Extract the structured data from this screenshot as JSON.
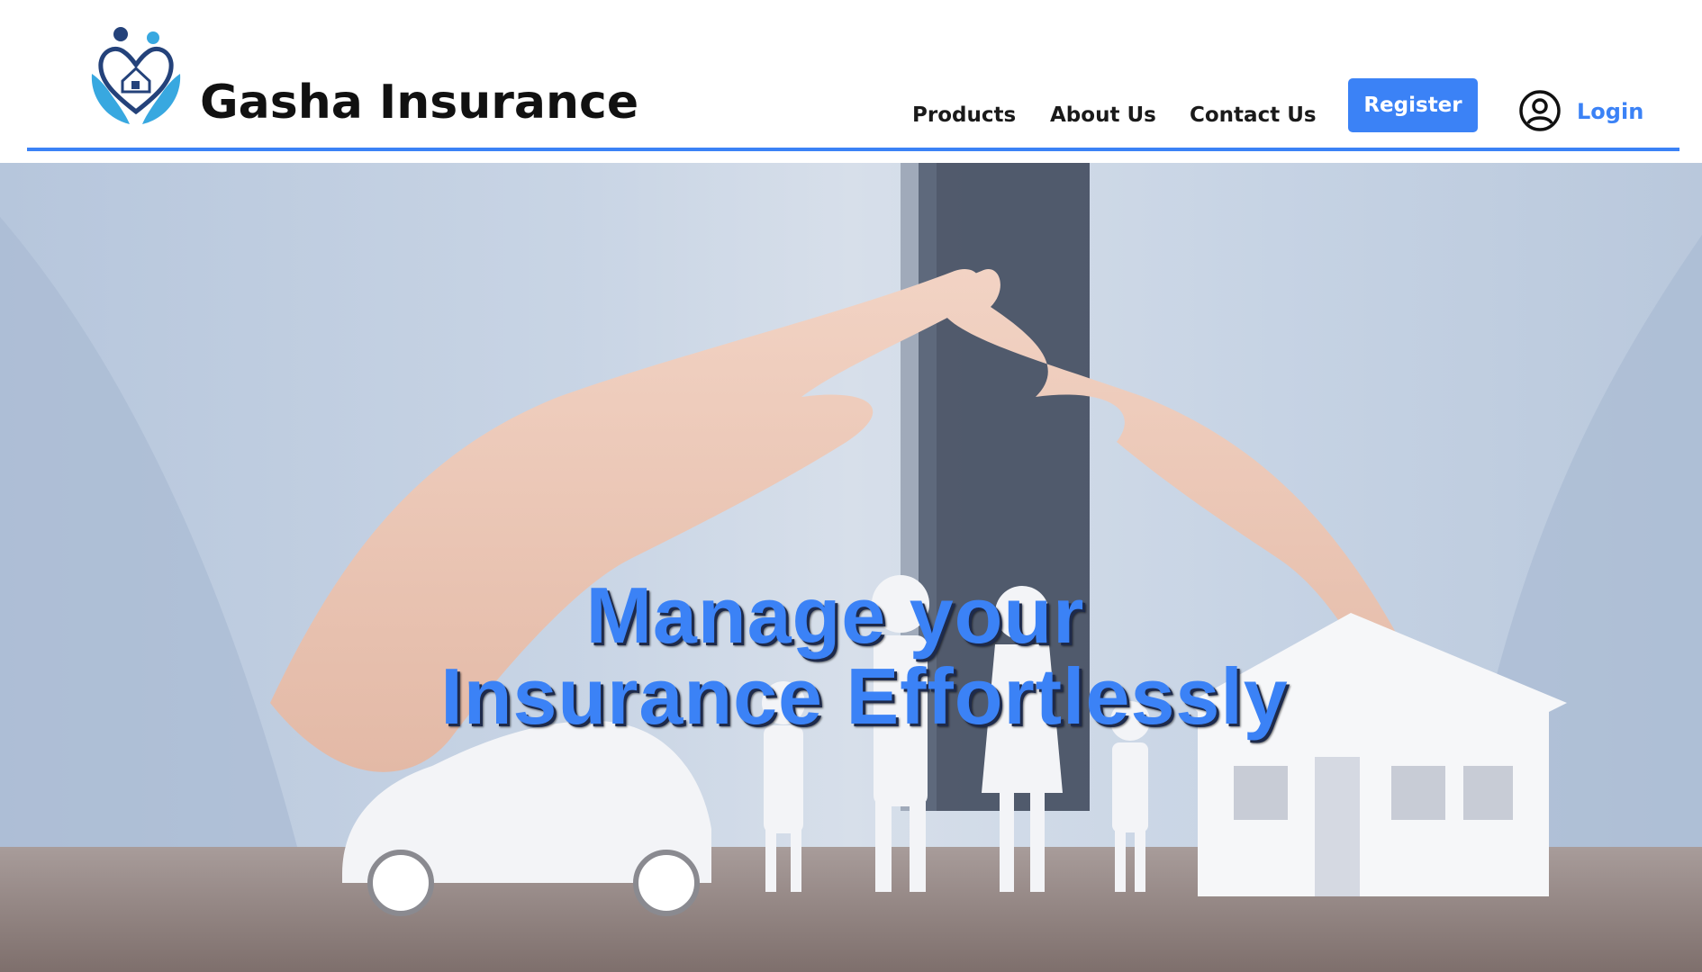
{
  "header": {
    "brand": "Gasha Insurance",
    "logo_icon": "family-hands-house-logo",
    "nav": {
      "products": "Products",
      "about": "About Us",
      "contact": "Contact Us"
    },
    "register_label": "Register",
    "login_label": "Login",
    "user_icon": "user-circle-icon"
  },
  "hero": {
    "headline_line1": "Manage your",
    "headline_line2": "Insurance Effortlessly",
    "image": "hands-protecting-car-family-house"
  },
  "colors": {
    "accent": "#3b82f6",
    "text": "#111111",
    "background": "#ffffff"
  }
}
